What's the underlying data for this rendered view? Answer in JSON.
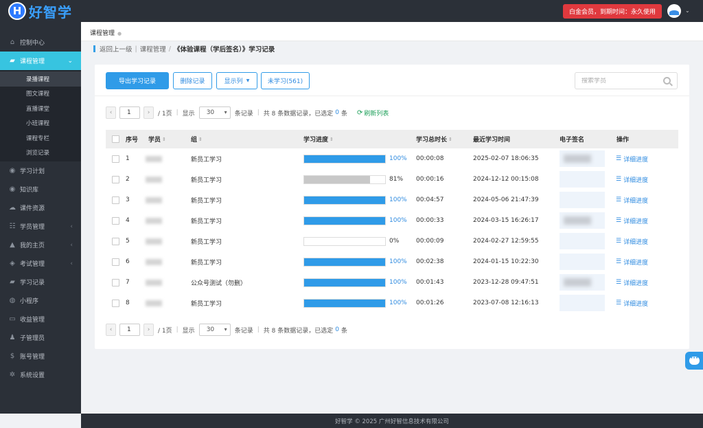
{
  "app": {
    "logo_letter": "H",
    "logo_text": "好智学"
  },
  "header": {
    "member_badge": "白金会员，到期时间：永久使用"
  },
  "sidebar": {
    "items": [
      {
        "label": "控制中心",
        "icon": "home-icon",
        "caret": ""
      },
      {
        "label": "课程管理",
        "icon": "book-icon",
        "caret": "⌄",
        "active": true
      },
      {
        "label": "学习计划",
        "icon": "eye-icon",
        "caret": ""
      },
      {
        "label": "知识库",
        "icon": "eye-icon",
        "caret": ""
      },
      {
        "label": "课件资源",
        "icon": "cloud-icon",
        "caret": ""
      },
      {
        "label": "学员管理",
        "icon": "users-icon",
        "caret": "‹"
      },
      {
        "label": "我的主页",
        "icon": "graduation-icon",
        "caret": "‹"
      },
      {
        "label": "考试管理",
        "icon": "tag-icon",
        "caret": "‹"
      },
      {
        "label": "学习记录",
        "icon": "book-icon",
        "caret": ""
      },
      {
        "label": "小程序",
        "icon": "wechat-icon",
        "caret": ""
      },
      {
        "label": "收益管理",
        "icon": "card-icon",
        "caret": ""
      },
      {
        "label": "子管理员",
        "icon": "user-icon",
        "caret": ""
      },
      {
        "label": "账号管理",
        "icon": "dollar-icon",
        "caret": ""
      },
      {
        "label": "系统设置",
        "icon": "gear-icon",
        "caret": ""
      }
    ],
    "sub_items": [
      "录播课程",
      "图文课程",
      "直播课堂",
      "小班课程",
      "课程专栏",
      "浏览记录"
    ]
  },
  "tabs": {
    "current": "课程管理"
  },
  "path": {
    "back": "返回上一级",
    "parent": "课程管理",
    "current": "《体验课程（学后签名）》学习记录"
  },
  "toolbar": {
    "export": "导出学习记录",
    "delete": "删除记录",
    "columns": "显示列",
    "unlearned": "未学习(561)",
    "search_placeholder": "搜索学员"
  },
  "pager": {
    "page": "1",
    "pages_text": "/ 1页",
    "show": "显示",
    "page_size": "30",
    "summary": "条记录",
    "total_text": "共 8 条数据记录，已选定",
    "selected": "0",
    "unit": "条",
    "refresh": "刷新列表"
  },
  "table": {
    "headers": {
      "index": "序号",
      "student": "学员",
      "group": "组",
      "progress": "学习进度",
      "duration": "学习总时长",
      "last_time": "最近学习时间",
      "signature": "电子签名",
      "action": "操作"
    },
    "action_label": "详细进度",
    "rows": [
      {
        "index": "1",
        "group": "新员工学习",
        "progress": 1.0,
        "progress_text": "100%",
        "duration": "00:00:08",
        "last_time": "2025-02-07 18:06:35",
        "signed": true
      },
      {
        "index": "2",
        "group": "新员工学习",
        "progress": 0.81,
        "progress_text": "81%",
        "duration": "00:00:16",
        "last_time": "2024-12-12 00:15:08",
        "signed": false
      },
      {
        "index": "3",
        "group": "新员工学习",
        "progress": 1.0,
        "progress_text": "100%",
        "duration": "00:04:57",
        "last_time": "2024-05-06 21:47:39",
        "signed": false
      },
      {
        "index": "4",
        "group": "新员工学习",
        "progress": 1.0,
        "progress_text": "100%",
        "duration": "00:00:33",
        "last_time": "2024-03-15 16:26:17",
        "signed": true
      },
      {
        "index": "5",
        "group": "新员工学习",
        "progress": 0.0,
        "progress_text": "0%",
        "duration": "00:00:09",
        "last_time": "2024-02-27 12:59:55",
        "signed": false
      },
      {
        "index": "6",
        "group": "新员工学习",
        "progress": 1.0,
        "progress_text": "100%",
        "duration": "00:02:38",
        "last_time": "2024-01-15 10:22:30",
        "signed": false
      },
      {
        "index": "7",
        "group": "公众号测试（勿删）",
        "progress": 1.0,
        "progress_text": "100%",
        "duration": "00:01:43",
        "last_time": "2023-12-28 09:47:51",
        "signed": true
      },
      {
        "index": "8",
        "group": "新员工学习",
        "progress": 1.0,
        "progress_text": "100%",
        "duration": "00:01:26",
        "last_time": "2023-07-08 12:16:13",
        "signed": false
      }
    ]
  },
  "colors": {
    "accent": "#2f9be8",
    "progress_full": "#2f9be8",
    "progress_partial": "#c8c8c8",
    "badge": "#e0393e",
    "sidebar_active": "#37c4e0"
  },
  "footer": {
    "text": "好智学 © 2025 广州好智信息技术有限公司"
  }
}
